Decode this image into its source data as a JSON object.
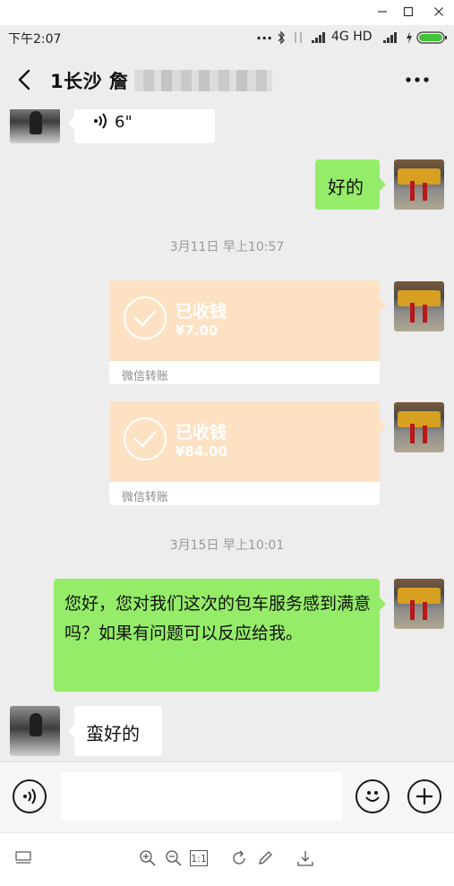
{
  "status_bar": {
    "time": "下午2:07",
    "dots": "...",
    "network": "4G HD"
  },
  "header": {
    "title": "1长沙 詹"
  },
  "messages": {
    "voice_duration": "6\"",
    "reply_ok": "好的",
    "timestamp_1": "3月11日 早上10:57",
    "transfer_1": {
      "status": "已收钱",
      "amount": "¥7.00",
      "label": "微信转账"
    },
    "transfer_2": {
      "status": "已收钱",
      "amount": "¥84.00",
      "label": "微信转账"
    },
    "timestamp_2": "3月15日 早上10:01",
    "survey": "您好，您对我们这次的包车服务感到满意吗？如果有问题可以反应给我。",
    "reply_good": "蛮好的"
  },
  "input": {
    "placeholder": ""
  },
  "viewer": {
    "actual_size_label": "1:1"
  },
  "colors": {
    "chat_bg": "#ededed",
    "bubble_green": "#95ec69",
    "transfer_orange": "#fde1c3"
  },
  "icons": [
    "minimize-icon",
    "maximize-icon",
    "close-icon",
    "bluetooth-icon",
    "signal-icon",
    "charging-icon",
    "battery-icon",
    "back-icon",
    "more-icon",
    "voice-icon",
    "voice-mode-icon",
    "emoji-icon",
    "plus-icon",
    "check-icon",
    "thumbnails-icon",
    "zoom-in-icon",
    "zoom-out-icon",
    "rotate-icon",
    "edit-icon",
    "download-icon"
  ]
}
